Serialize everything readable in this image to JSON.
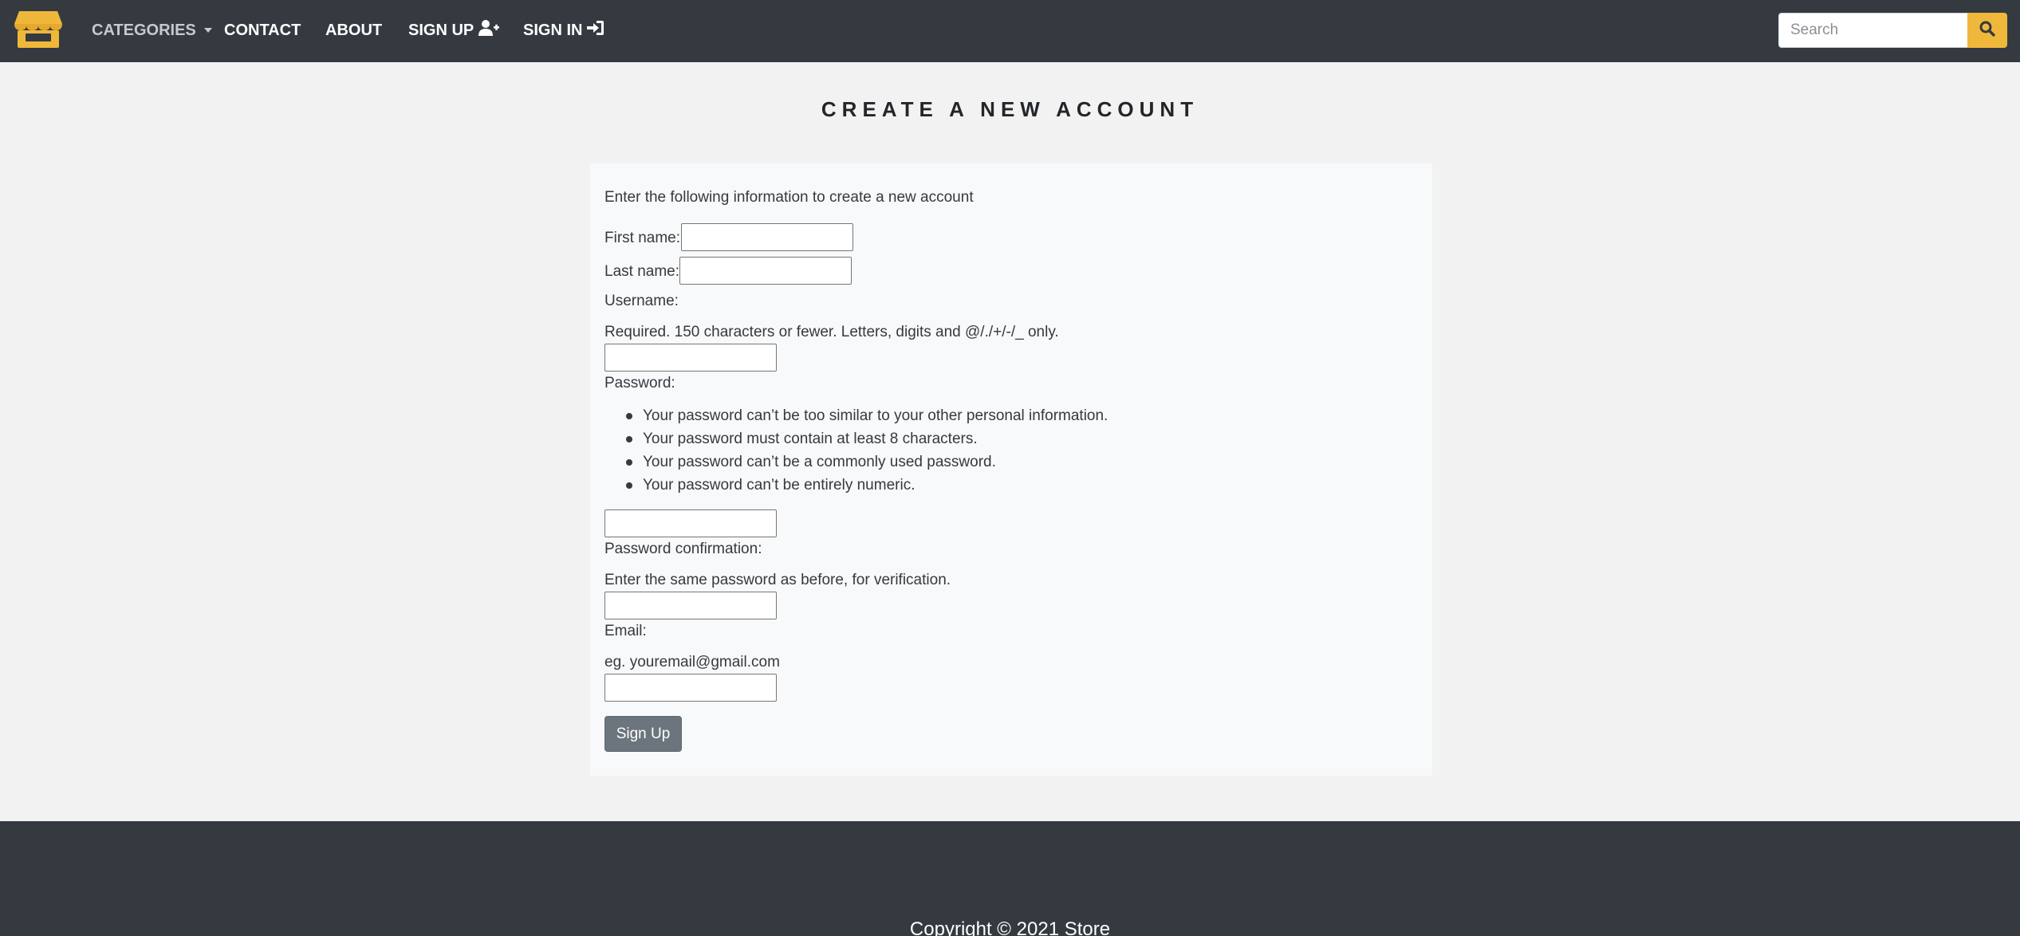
{
  "nav": {
    "categories": "CATEGORIES",
    "contact": "CONTACT",
    "about": "ABOUT",
    "sign_up": "SIGN UP",
    "sign_in": "SIGN IN",
    "search_placeholder": "Search"
  },
  "page": {
    "title": "CREATE A NEW ACCOUNT"
  },
  "form": {
    "intro": "Enter the following information to create a new account",
    "first_name_label": "First name:",
    "first_name_value": "",
    "last_name_label": "Last name:",
    "last_name_value": "",
    "username_label": "Username:",
    "username_help": "Required. 150 characters or fewer. Letters, digits and @/./+/-/_ only.",
    "username_value": "",
    "password_label": "Password:",
    "password_rules": [
      "Your password can’t be too similar to your other personal information.",
      "Your password must contain at least 8 characters.",
      "Your password can’t be a commonly used password.",
      "Your password can’t be entirely numeric."
    ],
    "password_value": "",
    "password_confirm_label": "Password confirmation:",
    "password_confirm_help": "Enter the same password as before, for verification.",
    "password_confirm_value": "",
    "email_label": "Email:",
    "email_help": "eg. youremail@gmail.com",
    "email_value": "",
    "submit_label": "Sign Up"
  },
  "footer": {
    "copyright": "Copyright © 2021 Store"
  },
  "colors": {
    "navbar": "#343a40",
    "accent": "#f0b83a",
    "button": "#6c757d"
  },
  "icons": {
    "logo": "store-icon",
    "sign_up": "user-plus-icon",
    "sign_in": "sign-in-icon",
    "search": "search-icon"
  }
}
